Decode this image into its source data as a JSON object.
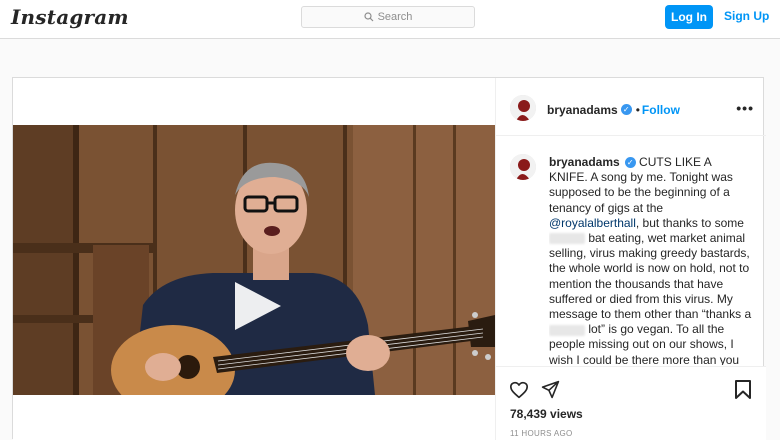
{
  "header": {
    "logo_text": "Instagram",
    "search_placeholder": "Search",
    "login_label": "Log In",
    "signup_label": "Sign Up"
  },
  "post": {
    "username": "bryanadams",
    "follow_label": "Follow",
    "separator": "•",
    "more_label": "•••",
    "caption": {
      "username": "bryanadams",
      "part1": "CUTS LIKE A KNIFE. A song by me. Tonight was supposed to be the beginning of a tenancy of gigs at the ",
      "mention": "@royalalberthall",
      "part2": ", but thanks to some ",
      "part3": " bat eating, wet market animal selling, virus making greedy bastards, the whole world is now on hold, not to mention the thousands that have suffered or died from this virus. My message to them other than “thanks a ",
      "part4": " lot” is go vegan. To all the people missing out on our shows, I wish I could be there more than you know. It’s been great hanging out in isolation with my"
    },
    "views": "78,439 views",
    "time_ago": "11 HOURS AGO"
  },
  "icons": {
    "search": "search-icon",
    "verified": "verified-badge-icon",
    "play": "play-icon",
    "heart": "heart-icon",
    "share": "share-icon",
    "bookmark": "bookmark-icon"
  },
  "colors": {
    "accent": "#0095f6",
    "mention": "#00376b",
    "verified": "#3897f0"
  }
}
